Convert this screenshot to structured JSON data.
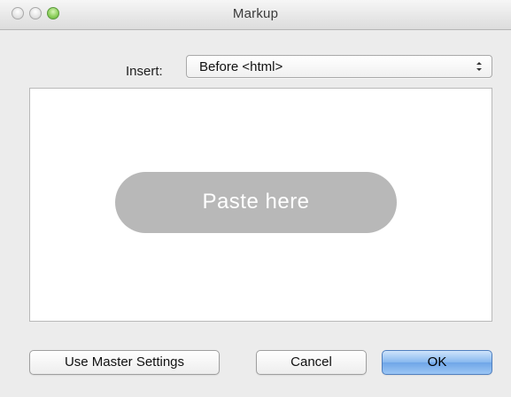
{
  "window": {
    "title": "Markup"
  },
  "insert": {
    "label": "Insert:",
    "selected": "Before <html>"
  },
  "paste_area": {
    "prompt": "Paste here"
  },
  "buttons": {
    "master_settings": "Use Master Settings",
    "cancel": "Cancel",
    "ok": "OK"
  },
  "icons": {
    "close": "close-icon",
    "minimize": "minimize-icon",
    "zoom": "zoom-icon",
    "select_arrows": "chevron-up-down-icon"
  },
  "colors": {
    "background": "#ececec",
    "pill": "#b8b8b8",
    "ok_button": "#87b8ef",
    "zoom_button": "#8fd05e"
  }
}
